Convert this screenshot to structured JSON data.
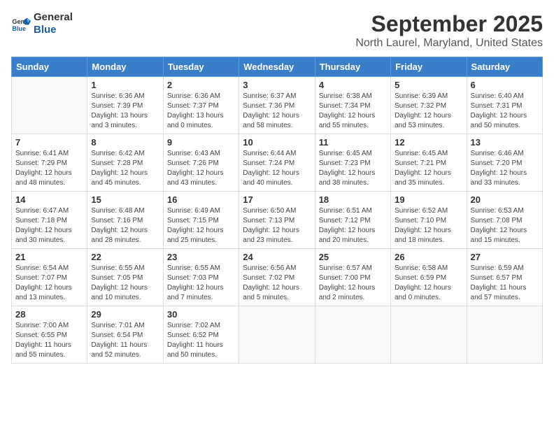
{
  "logo": {
    "text_general": "General",
    "text_blue": "Blue"
  },
  "header": {
    "month_year": "September 2025",
    "location": "North Laurel, Maryland, United States"
  },
  "weekdays": [
    "Sunday",
    "Monday",
    "Tuesday",
    "Wednesday",
    "Thursday",
    "Friday",
    "Saturday"
  ],
  "weeks": [
    [
      {
        "day": "",
        "info": ""
      },
      {
        "day": "1",
        "info": "Sunrise: 6:36 AM\nSunset: 7:39 PM\nDaylight: 13 hours\nand 3 minutes."
      },
      {
        "day": "2",
        "info": "Sunrise: 6:36 AM\nSunset: 7:37 PM\nDaylight: 13 hours\nand 0 minutes."
      },
      {
        "day": "3",
        "info": "Sunrise: 6:37 AM\nSunset: 7:36 PM\nDaylight: 12 hours\nand 58 minutes."
      },
      {
        "day": "4",
        "info": "Sunrise: 6:38 AM\nSunset: 7:34 PM\nDaylight: 12 hours\nand 55 minutes."
      },
      {
        "day": "5",
        "info": "Sunrise: 6:39 AM\nSunset: 7:32 PM\nDaylight: 12 hours\nand 53 minutes."
      },
      {
        "day": "6",
        "info": "Sunrise: 6:40 AM\nSunset: 7:31 PM\nDaylight: 12 hours\nand 50 minutes."
      }
    ],
    [
      {
        "day": "7",
        "info": "Sunrise: 6:41 AM\nSunset: 7:29 PM\nDaylight: 12 hours\nand 48 minutes."
      },
      {
        "day": "8",
        "info": "Sunrise: 6:42 AM\nSunset: 7:28 PM\nDaylight: 12 hours\nand 45 minutes."
      },
      {
        "day": "9",
        "info": "Sunrise: 6:43 AM\nSunset: 7:26 PM\nDaylight: 12 hours\nand 43 minutes."
      },
      {
        "day": "10",
        "info": "Sunrise: 6:44 AM\nSunset: 7:24 PM\nDaylight: 12 hours\nand 40 minutes."
      },
      {
        "day": "11",
        "info": "Sunrise: 6:45 AM\nSunset: 7:23 PM\nDaylight: 12 hours\nand 38 minutes."
      },
      {
        "day": "12",
        "info": "Sunrise: 6:45 AM\nSunset: 7:21 PM\nDaylight: 12 hours\nand 35 minutes."
      },
      {
        "day": "13",
        "info": "Sunrise: 6:46 AM\nSunset: 7:20 PM\nDaylight: 12 hours\nand 33 minutes."
      }
    ],
    [
      {
        "day": "14",
        "info": "Sunrise: 6:47 AM\nSunset: 7:18 PM\nDaylight: 12 hours\nand 30 minutes."
      },
      {
        "day": "15",
        "info": "Sunrise: 6:48 AM\nSunset: 7:16 PM\nDaylight: 12 hours\nand 28 minutes."
      },
      {
        "day": "16",
        "info": "Sunrise: 6:49 AM\nSunset: 7:15 PM\nDaylight: 12 hours\nand 25 minutes."
      },
      {
        "day": "17",
        "info": "Sunrise: 6:50 AM\nSunset: 7:13 PM\nDaylight: 12 hours\nand 23 minutes."
      },
      {
        "day": "18",
        "info": "Sunrise: 6:51 AM\nSunset: 7:12 PM\nDaylight: 12 hours\nand 20 minutes."
      },
      {
        "day": "19",
        "info": "Sunrise: 6:52 AM\nSunset: 7:10 PM\nDaylight: 12 hours\nand 18 minutes."
      },
      {
        "day": "20",
        "info": "Sunrise: 6:53 AM\nSunset: 7:08 PM\nDaylight: 12 hours\nand 15 minutes."
      }
    ],
    [
      {
        "day": "21",
        "info": "Sunrise: 6:54 AM\nSunset: 7:07 PM\nDaylight: 12 hours\nand 13 minutes."
      },
      {
        "day": "22",
        "info": "Sunrise: 6:55 AM\nSunset: 7:05 PM\nDaylight: 12 hours\nand 10 minutes."
      },
      {
        "day": "23",
        "info": "Sunrise: 6:55 AM\nSunset: 7:03 PM\nDaylight: 12 hours\nand 7 minutes."
      },
      {
        "day": "24",
        "info": "Sunrise: 6:56 AM\nSunset: 7:02 PM\nDaylight: 12 hours\nand 5 minutes."
      },
      {
        "day": "25",
        "info": "Sunrise: 6:57 AM\nSunset: 7:00 PM\nDaylight: 12 hours\nand 2 minutes."
      },
      {
        "day": "26",
        "info": "Sunrise: 6:58 AM\nSunset: 6:59 PM\nDaylight: 12 hours\nand 0 minutes."
      },
      {
        "day": "27",
        "info": "Sunrise: 6:59 AM\nSunset: 6:57 PM\nDaylight: 11 hours\nand 57 minutes."
      }
    ],
    [
      {
        "day": "28",
        "info": "Sunrise: 7:00 AM\nSunset: 6:55 PM\nDaylight: 11 hours\nand 55 minutes."
      },
      {
        "day": "29",
        "info": "Sunrise: 7:01 AM\nSunset: 6:54 PM\nDaylight: 11 hours\nand 52 minutes."
      },
      {
        "day": "30",
        "info": "Sunrise: 7:02 AM\nSunset: 6:52 PM\nDaylight: 11 hours\nand 50 minutes."
      },
      {
        "day": "",
        "info": ""
      },
      {
        "day": "",
        "info": ""
      },
      {
        "day": "",
        "info": ""
      },
      {
        "day": "",
        "info": ""
      }
    ]
  ]
}
